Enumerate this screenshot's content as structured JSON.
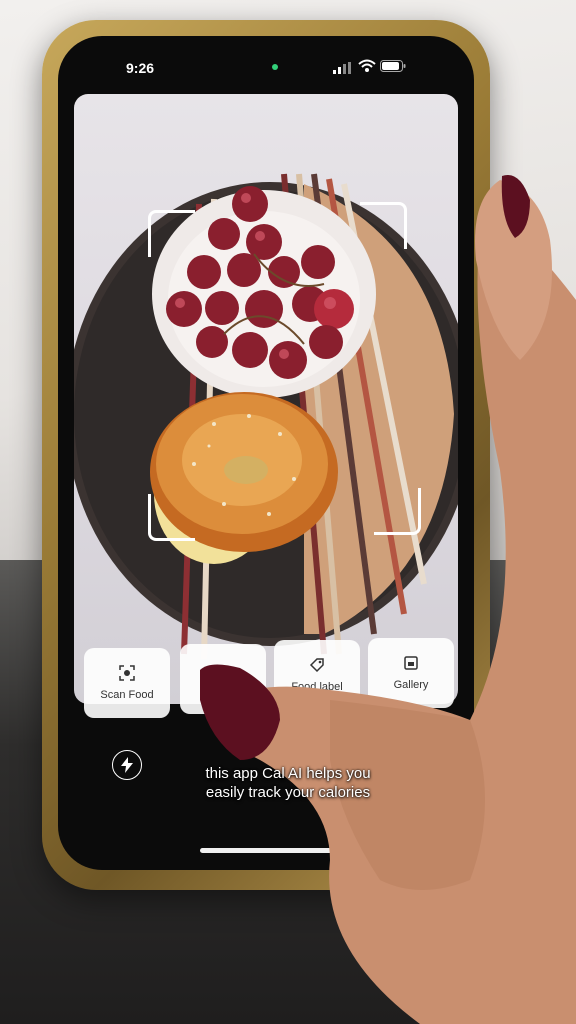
{
  "status_bar": {
    "time": "9:26"
  },
  "toolbar": {
    "scan_food": "Scan Food",
    "barcode": "",
    "food_label": "Food label",
    "gallery": "Gallery"
  },
  "caption": {
    "line1": "this app Cal AI helps you",
    "line2": "easily track your calories"
  },
  "icons": {
    "flash": "flash-icon",
    "scan": "scan-food-icon",
    "label": "food-label-icon",
    "gallery": "gallery-icon"
  },
  "colors": {
    "phone_frame": "#9a7b36",
    "viewfinder_bg": "#dcd8df",
    "button_bg": "#ffffff",
    "caption_text": "#ffffff"
  }
}
